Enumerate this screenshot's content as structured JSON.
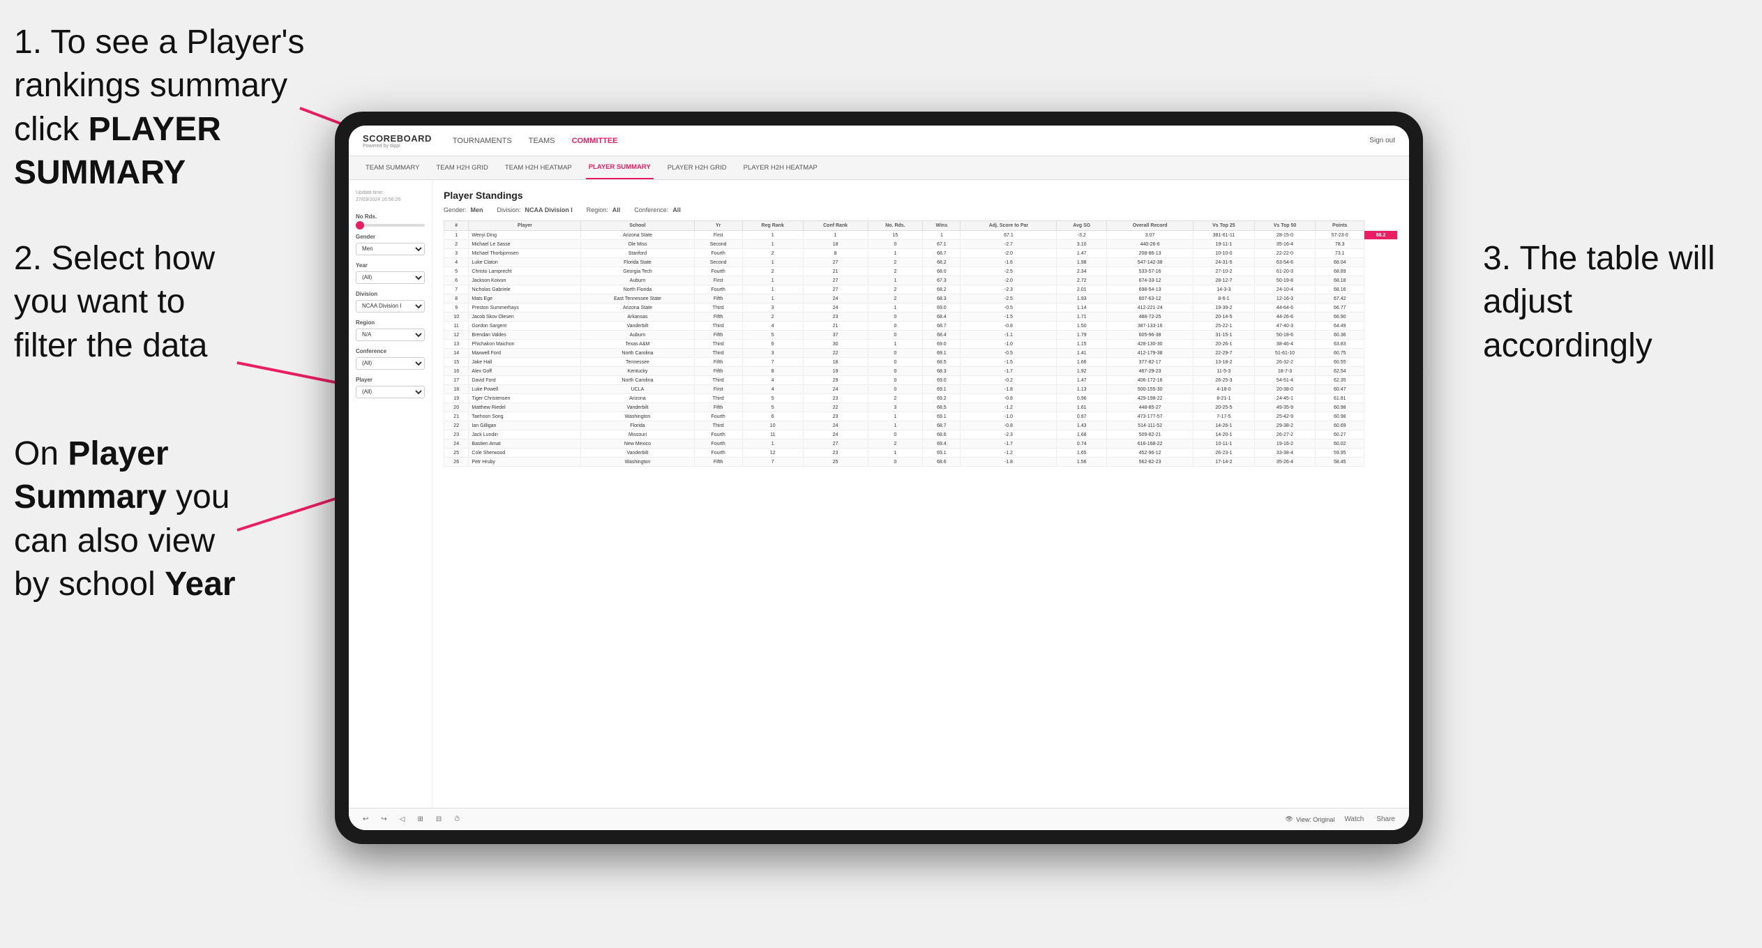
{
  "instructions": {
    "step1": "1. To see a Player's rankings summary click ",
    "step1_bold": "PLAYER SUMMARY",
    "step2_line1": "2. Select how",
    "step2_line2": "you want to",
    "step2_line3": "filter the data",
    "step3_line1": "On ",
    "step3_bold1": "Player",
    "step3_line2": "Summary",
    "step3_bold2": " you",
    "step3_line3": "can also view",
    "step3_line4": "by school ",
    "step3_bold3": "Year",
    "step4_line1": "3. The table will",
    "step4_line2": "adjust accordingly"
  },
  "nav": {
    "logo_main": "SCOREBOARD",
    "logo_sub": "Powered by dippi",
    "links": [
      "TOURNAMENTS",
      "TEAMS",
      "COMMITTEE"
    ],
    "sign_out": "Sign out"
  },
  "sub_nav": {
    "links": [
      "TEAM SUMMARY",
      "TEAM H2H GRID",
      "TEAM H2H HEATMAP",
      "PLAYER SUMMARY",
      "PLAYER H2H GRID",
      "PLAYER H2H HEATMAP"
    ]
  },
  "sidebar": {
    "update_label": "Update time:",
    "update_value": "27/03/2024 16:56:26",
    "no_rds_label": "No Rds.",
    "gender_label": "Gender",
    "gender_value": "Men",
    "year_label": "Year",
    "year_value": "(All)",
    "division_label": "Division",
    "division_value": "NCAA Division I",
    "region_label": "Region",
    "region_value": "N/A",
    "conference_label": "Conference",
    "conference_value": "(All)",
    "player_label": "Player",
    "player_value": "(All)"
  },
  "standings": {
    "title": "Player Standings",
    "gender_label": "Gender:",
    "gender_value": "Men",
    "division_label": "Division:",
    "division_value": "NCAA Division I",
    "region_label": "Region:",
    "region_value": "All",
    "conference_label": "Conference:",
    "conference_value": "All"
  },
  "table": {
    "headers": [
      "#",
      "Player",
      "School",
      "Yr",
      "Reg Rank",
      "Conf Rank",
      "No. Rds.",
      "Wins",
      "Adj. Score to Par",
      "Avg SG",
      "Overall Record",
      "Vs Top 25",
      "Vs Top 50",
      "Points"
    ],
    "rows": [
      [
        "1",
        "Wenyi Ding",
        "Arizona State",
        "First",
        "1",
        "1",
        "15",
        "1",
        "67.1",
        "-3.2",
        "3.07",
        "381-61-11",
        "28-15-0",
        "57-23-0",
        "88.2"
      ],
      [
        "2",
        "Michael Le Sasse",
        "Ole Miss",
        "Second",
        "1",
        "18",
        "0",
        "67.1",
        "-2.7",
        "3.10",
        "440-26-6",
        "19-11-1",
        "35-16-4",
        "78.3"
      ],
      [
        "3",
        "Michael Thorbjornsen",
        "Stanford",
        "Fourth",
        "2",
        "8",
        "1",
        "68.7",
        "-2.0",
        "1.47",
        "208-86-13",
        "10-10-0",
        "22-22-0",
        "73.1"
      ],
      [
        "4",
        "Luke Claton",
        "Florida State",
        "Second",
        "1",
        "27",
        "2",
        "68.2",
        "-1.6",
        "1.98",
        "547-142-38",
        "24-31-5",
        "63-54-6",
        "68.04"
      ],
      [
        "5",
        "Christo Lamprecht",
        "Georgia Tech",
        "Fourth",
        "2",
        "21",
        "2",
        "68.0",
        "-2.5",
        "2.34",
        "533-57-16",
        "27-10-2",
        "61-20-3",
        "68.89"
      ],
      [
        "6",
        "Jackson Koivun",
        "Auburn",
        "First",
        "1",
        "27",
        "1",
        "67.3",
        "-2.0",
        "2.72",
        "674-33-12",
        "28-12-7",
        "50-19-8",
        "68.18"
      ],
      [
        "7",
        "Nicholas Gabriele",
        "North Florida",
        "Fourth",
        "1",
        "27",
        "2",
        "68.2",
        "-2.3",
        "2.01",
        "698-54-13",
        "14-3-3",
        "24-10-4",
        "68.16"
      ],
      [
        "8",
        "Mats Ege",
        "East Tennessee State",
        "Fifth",
        "1",
        "24",
        "2",
        "68.3",
        "-2.5",
        "1.93",
        "607-63-12",
        "8-6-1",
        "12-16-3",
        "67.42"
      ],
      [
        "9",
        "Preston Summerhays",
        "Arizona State",
        "Third",
        "3",
        "24",
        "1",
        "69.0",
        "-0.5",
        "1.14",
        "412-221-24",
        "19-39-2",
        "44-64-6",
        "66.77"
      ],
      [
        "10",
        "Jacob Skov Olesen",
        "Arkansas",
        "Fifth",
        "2",
        "23",
        "0",
        "68.4",
        "-1.5",
        "1.71",
        "488-72-25",
        "20-14-5",
        "44-26-6",
        "66.90"
      ],
      [
        "11",
        "Gordon Sargent",
        "Vanderbilt",
        "Third",
        "4",
        "21",
        "0",
        "68.7",
        "-0.8",
        "1.50",
        "387-133-16",
        "25-22-1",
        "47-40-3",
        "64.49"
      ],
      [
        "12",
        "Brendan Valdes",
        "Auburn",
        "Fifth",
        "5",
        "37",
        "0",
        "68.4",
        "-1.1",
        "1.79",
        "605-96-38",
        "31-15-1",
        "50-18-6",
        "60.36"
      ],
      [
        "13",
        "Phichakon Maichon",
        "Texas A&M",
        "Third",
        "6",
        "30",
        "1",
        "69.0",
        "-1.0",
        "1.15",
        "428-130-30",
        "20-26-1",
        "38-46-4",
        "63.83"
      ],
      [
        "14",
        "Maxwell Ford",
        "North Carolina",
        "Third",
        "3",
        "22",
        "0",
        "69.1",
        "-0.5",
        "1.41",
        "412-179-38",
        "22-29-7",
        "51-61-10",
        "60.75"
      ],
      [
        "15",
        "Jake Hall",
        "Tennessee",
        "Fifth",
        "7",
        "18",
        "0",
        "68.5",
        "-1.5",
        "1.66",
        "377-82-17",
        "13-18-2",
        "26-32-2",
        "60.55"
      ],
      [
        "16",
        "Alex Goff",
        "Kentucky",
        "Fifth",
        "8",
        "19",
        "0",
        "68.3",
        "-1.7",
        "1.92",
        "467-29-23",
        "11-5-3",
        "18-7-3",
        "62.54"
      ],
      [
        "17",
        "David Ford",
        "North Carolina",
        "Third",
        "4",
        "29",
        "0",
        "69.0",
        "-0.2",
        "1.47",
        "406-172-16",
        "26-25-3",
        "54-51-4",
        "62.35"
      ],
      [
        "18",
        "Luke Powell",
        "UCLA",
        "First",
        "4",
        "24",
        "0",
        "69.1",
        "-1.8",
        "1.13",
        "500-155-30",
        "4-18-0",
        "20-38-0",
        "60.47"
      ],
      [
        "19",
        "Tiger Christensen",
        "Arizona",
        "Third",
        "5",
        "23",
        "2",
        "69.2",
        "-0.8",
        "0.96",
        "429-198-22",
        "8-21-1",
        "24-45-1",
        "61.81"
      ],
      [
        "20",
        "Matthew Riedel",
        "Vanderbilt",
        "Fifth",
        "5",
        "22",
        "3",
        "68.5",
        "-1.2",
        "1.61",
        "448-85-27",
        "20-25-5",
        "49-35-9",
        "60.98"
      ],
      [
        "21",
        "Taehoon Song",
        "Washington",
        "Fourth",
        "6",
        "23",
        "1",
        "69.1",
        "-1.0",
        "0.87",
        "473-177-57",
        "7-17-5",
        "25-42-9",
        "60.98"
      ],
      [
        "22",
        "Ian Gilligan",
        "Florida",
        "Third",
        "10",
        "24",
        "1",
        "68.7",
        "-0.8",
        "1.43",
        "514-111-52",
        "14-26-1",
        "29-38-2",
        "60.69"
      ],
      [
        "23",
        "Jack Lundin",
        "Missouri",
        "Fourth",
        "11",
        "24",
        "0",
        "68.6",
        "-2.3",
        "1.68",
        "509-82-21",
        "14-20-1",
        "26-27-2",
        "60.27"
      ],
      [
        "24",
        "Bastien Amat",
        "New Mexico",
        "Fourth",
        "1",
        "27",
        "2",
        "69.4",
        "-1.7",
        "0.74",
        "616-168-22",
        "10-11-1",
        "19-16-2",
        "60.02"
      ],
      [
        "25",
        "Cole Sherwood",
        "Vanderbilt",
        "Fourth",
        "12",
        "23",
        "1",
        "69.1",
        "-1.2",
        "1.65",
        "452-96-12",
        "26-23-1",
        "33-38-4",
        "59.95"
      ],
      [
        "26",
        "Petr Hruby",
        "Washington",
        "Fifth",
        "7",
        "25",
        "0",
        "68.6",
        "-1.8",
        "1.56",
        "562-82-23",
        "17-14-2",
        "35-26-4",
        "58.45"
      ]
    ]
  },
  "toolbar": {
    "view_label": "View: Original",
    "watch_label": "Watch",
    "share_label": "Share"
  }
}
